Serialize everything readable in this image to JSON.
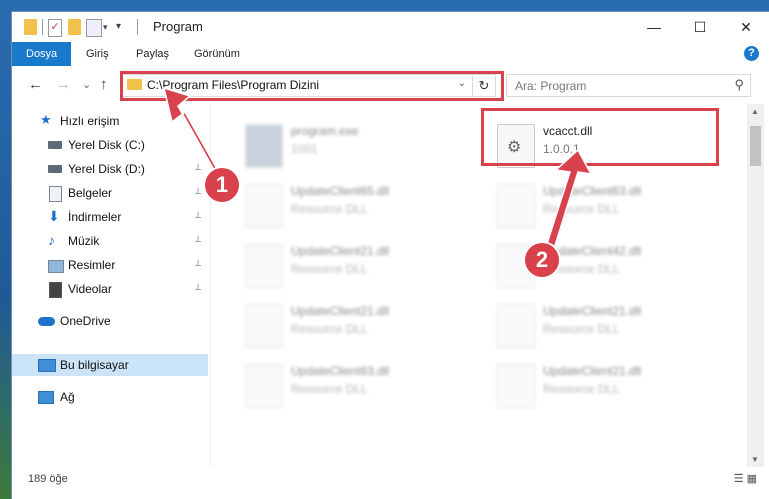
{
  "window": {
    "title": "Program",
    "minimize": "—",
    "maximize": "☐",
    "close": "✕"
  },
  "ribbon": {
    "tabs": [
      {
        "label": "Dosya",
        "active": true
      },
      {
        "label": "Giriş"
      },
      {
        "label": "Paylaş"
      },
      {
        "label": "Görünüm"
      }
    ],
    "help": "?"
  },
  "nav": {
    "back": "←",
    "forward": "→",
    "recent": "⌄",
    "up": "↑",
    "address": "C:\\Program Files\\Program Dizini",
    "address_dropdown": "⌄",
    "refresh": "↻",
    "search_placeholder": "Ara: Program"
  },
  "sidebar": {
    "items": [
      {
        "label": "Hızlı erişim",
        "icon": "star-icon"
      },
      {
        "label": "Yerel Disk (C:)",
        "icon": "disk-icon"
      },
      {
        "label": "Yerel Disk (D:)",
        "icon": "disk-icon"
      },
      {
        "label": "Belgeler",
        "icon": "documents-icon"
      },
      {
        "label": "İndirmeler",
        "icon": "download-icon"
      },
      {
        "label": "Müzik",
        "icon": "music-icon"
      },
      {
        "label": "Resimler",
        "icon": "pictures-icon"
      },
      {
        "label": "Videolar",
        "icon": "videos-icon"
      },
      {
        "label": "OneDrive",
        "icon": "cloud-icon"
      },
      {
        "label": "Bu bilgisayar",
        "icon": "computer-icon"
      },
      {
        "label": "Ağ",
        "icon": "network-icon"
      }
    ],
    "pin": "📌"
  },
  "files": [
    {
      "name": "program.exe",
      "type": "1001",
      "blurred": true
    },
    {
      "name": "vcacct.dll",
      "type": "1.0.0.1",
      "blurred": false
    },
    {
      "name": "UpdateClient65.dll",
      "type": "Resource DLL",
      "blurred": true
    },
    {
      "name": "UpdateClient63.dll",
      "type": "Resource DLL",
      "blurred": true
    },
    {
      "name": "UpdateClient21.dll",
      "type": "Resource DLL",
      "blurred": true
    },
    {
      "name": "UpdateClient42.dll",
      "type": "Resource DLL",
      "blurred": true
    },
    {
      "name": "UpdateClient21.dll",
      "type": "Resource DLL",
      "blurred": true
    },
    {
      "name": "UpdateClient21.dll",
      "type": "Resource DLL",
      "blurred": true
    },
    {
      "name": "UpdateClient63.dll",
      "type": "Resource DLL",
      "blurred": true
    },
    {
      "name": "UpdateClient21.dll",
      "type": "Resource DLL",
      "blurred": true
    }
  ],
  "status": {
    "count": "189 öğe"
  },
  "annotations": {
    "marker1": "1",
    "marker2": "2",
    "color": "#d9424c"
  }
}
